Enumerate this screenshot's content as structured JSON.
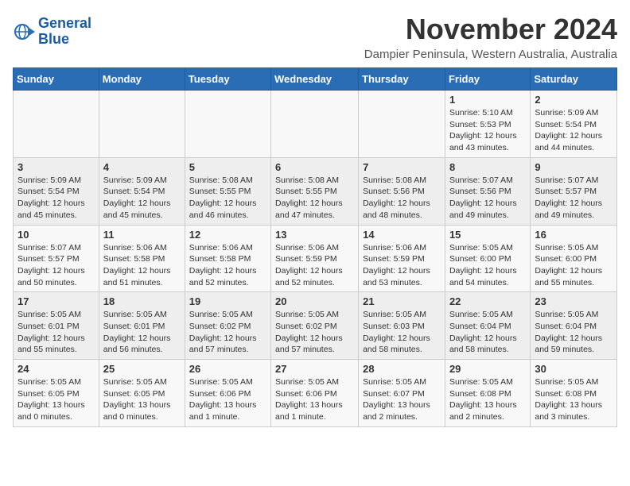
{
  "logo": {
    "line1": "General",
    "line2": "Blue"
  },
  "title": "November 2024",
  "subtitle": "Dampier Peninsula, Western Australia, Australia",
  "weekdays": [
    "Sunday",
    "Monday",
    "Tuesday",
    "Wednesday",
    "Thursday",
    "Friday",
    "Saturday"
  ],
  "weeks": [
    [
      {
        "day": "",
        "info": ""
      },
      {
        "day": "",
        "info": ""
      },
      {
        "day": "",
        "info": ""
      },
      {
        "day": "",
        "info": ""
      },
      {
        "day": "",
        "info": ""
      },
      {
        "day": "1",
        "info": "Sunrise: 5:10 AM\nSunset: 5:53 PM\nDaylight: 12 hours\nand 43 minutes."
      },
      {
        "day": "2",
        "info": "Sunrise: 5:09 AM\nSunset: 5:54 PM\nDaylight: 12 hours\nand 44 minutes."
      }
    ],
    [
      {
        "day": "3",
        "info": "Sunrise: 5:09 AM\nSunset: 5:54 PM\nDaylight: 12 hours\nand 45 minutes."
      },
      {
        "day": "4",
        "info": "Sunrise: 5:09 AM\nSunset: 5:54 PM\nDaylight: 12 hours\nand 45 minutes."
      },
      {
        "day": "5",
        "info": "Sunrise: 5:08 AM\nSunset: 5:55 PM\nDaylight: 12 hours\nand 46 minutes."
      },
      {
        "day": "6",
        "info": "Sunrise: 5:08 AM\nSunset: 5:55 PM\nDaylight: 12 hours\nand 47 minutes."
      },
      {
        "day": "7",
        "info": "Sunrise: 5:08 AM\nSunset: 5:56 PM\nDaylight: 12 hours\nand 48 minutes."
      },
      {
        "day": "8",
        "info": "Sunrise: 5:07 AM\nSunset: 5:56 PM\nDaylight: 12 hours\nand 49 minutes."
      },
      {
        "day": "9",
        "info": "Sunrise: 5:07 AM\nSunset: 5:57 PM\nDaylight: 12 hours\nand 49 minutes."
      }
    ],
    [
      {
        "day": "10",
        "info": "Sunrise: 5:07 AM\nSunset: 5:57 PM\nDaylight: 12 hours\nand 50 minutes."
      },
      {
        "day": "11",
        "info": "Sunrise: 5:06 AM\nSunset: 5:58 PM\nDaylight: 12 hours\nand 51 minutes."
      },
      {
        "day": "12",
        "info": "Sunrise: 5:06 AM\nSunset: 5:58 PM\nDaylight: 12 hours\nand 52 minutes."
      },
      {
        "day": "13",
        "info": "Sunrise: 5:06 AM\nSunset: 5:59 PM\nDaylight: 12 hours\nand 52 minutes."
      },
      {
        "day": "14",
        "info": "Sunrise: 5:06 AM\nSunset: 5:59 PM\nDaylight: 12 hours\nand 53 minutes."
      },
      {
        "day": "15",
        "info": "Sunrise: 5:05 AM\nSunset: 6:00 PM\nDaylight: 12 hours\nand 54 minutes."
      },
      {
        "day": "16",
        "info": "Sunrise: 5:05 AM\nSunset: 6:00 PM\nDaylight: 12 hours\nand 55 minutes."
      }
    ],
    [
      {
        "day": "17",
        "info": "Sunrise: 5:05 AM\nSunset: 6:01 PM\nDaylight: 12 hours\nand 55 minutes."
      },
      {
        "day": "18",
        "info": "Sunrise: 5:05 AM\nSunset: 6:01 PM\nDaylight: 12 hours\nand 56 minutes."
      },
      {
        "day": "19",
        "info": "Sunrise: 5:05 AM\nSunset: 6:02 PM\nDaylight: 12 hours\nand 57 minutes."
      },
      {
        "day": "20",
        "info": "Sunrise: 5:05 AM\nSunset: 6:02 PM\nDaylight: 12 hours\nand 57 minutes."
      },
      {
        "day": "21",
        "info": "Sunrise: 5:05 AM\nSunset: 6:03 PM\nDaylight: 12 hours\nand 58 minutes."
      },
      {
        "day": "22",
        "info": "Sunrise: 5:05 AM\nSunset: 6:04 PM\nDaylight: 12 hours\nand 58 minutes."
      },
      {
        "day": "23",
        "info": "Sunrise: 5:05 AM\nSunset: 6:04 PM\nDaylight: 12 hours\nand 59 minutes."
      }
    ],
    [
      {
        "day": "24",
        "info": "Sunrise: 5:05 AM\nSunset: 6:05 PM\nDaylight: 13 hours\nand 0 minutes."
      },
      {
        "day": "25",
        "info": "Sunrise: 5:05 AM\nSunset: 6:05 PM\nDaylight: 13 hours\nand 0 minutes."
      },
      {
        "day": "26",
        "info": "Sunrise: 5:05 AM\nSunset: 6:06 PM\nDaylight: 13 hours\nand 1 minute."
      },
      {
        "day": "27",
        "info": "Sunrise: 5:05 AM\nSunset: 6:06 PM\nDaylight: 13 hours\nand 1 minute."
      },
      {
        "day": "28",
        "info": "Sunrise: 5:05 AM\nSunset: 6:07 PM\nDaylight: 13 hours\nand 2 minutes."
      },
      {
        "day": "29",
        "info": "Sunrise: 5:05 AM\nSunset: 6:08 PM\nDaylight: 13 hours\nand 2 minutes."
      },
      {
        "day": "30",
        "info": "Sunrise: 5:05 AM\nSunset: 6:08 PM\nDaylight: 13 hours\nand 3 minutes."
      }
    ]
  ]
}
